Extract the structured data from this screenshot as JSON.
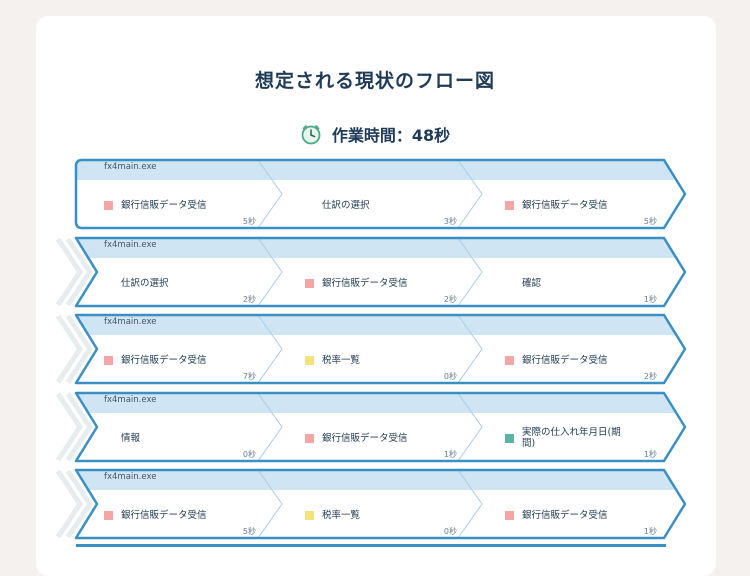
{
  "title": "想定される現状のフロー図",
  "work_time": "作業時間：48秒",
  "colors": {
    "pink": "#f4a6a6",
    "yellow": "#f5e27a",
    "teal": "#5bb3a7",
    "border": "#3a8fc4",
    "band": "#cfe5f4"
  },
  "rows": [
    {
      "exe": "fx4main.exe",
      "steps": [
        {
          "label": "銀行信販データ受信",
          "icon": "pink",
          "duration": "5秒"
        },
        {
          "label": "仕訳の選択",
          "icon": "none",
          "duration": "3秒"
        },
        {
          "label": "銀行信販データ受信",
          "icon": "pink",
          "duration": "5秒"
        }
      ]
    },
    {
      "exe": "fx4main.exe",
      "steps": [
        {
          "label": "仕訳の選択",
          "icon": "none",
          "duration": "2秒"
        },
        {
          "label": "銀行信販データ受信",
          "icon": "pink",
          "duration": "2秒"
        },
        {
          "label": "確認",
          "icon": "none",
          "duration": "1秒"
        }
      ]
    },
    {
      "exe": "fx4main.exe",
      "steps": [
        {
          "label": "銀行信販データ受信",
          "icon": "pink",
          "duration": "7秒"
        },
        {
          "label": "税率一覧",
          "icon": "yellow",
          "duration": "0秒"
        },
        {
          "label": "銀行信販データ受信",
          "icon": "pink",
          "duration": "2秒"
        }
      ]
    },
    {
      "exe": "fx4main.exe",
      "steps": [
        {
          "label": "情報",
          "icon": "none",
          "duration": "0秒"
        },
        {
          "label": "銀行信販データ受信",
          "icon": "pink",
          "duration": "1秒"
        },
        {
          "label": "実際の仕入れ年月日(期間)",
          "icon": "teal",
          "duration": "1秒"
        }
      ]
    },
    {
      "exe": "fx4main.exe",
      "steps": [
        {
          "label": "銀行信販データ受信",
          "icon": "pink",
          "duration": "5秒"
        },
        {
          "label": "税率一覧",
          "icon": "yellow",
          "duration": "0秒"
        },
        {
          "label": "銀行信販データ受信",
          "icon": "pink",
          "duration": "1秒"
        }
      ]
    }
  ]
}
